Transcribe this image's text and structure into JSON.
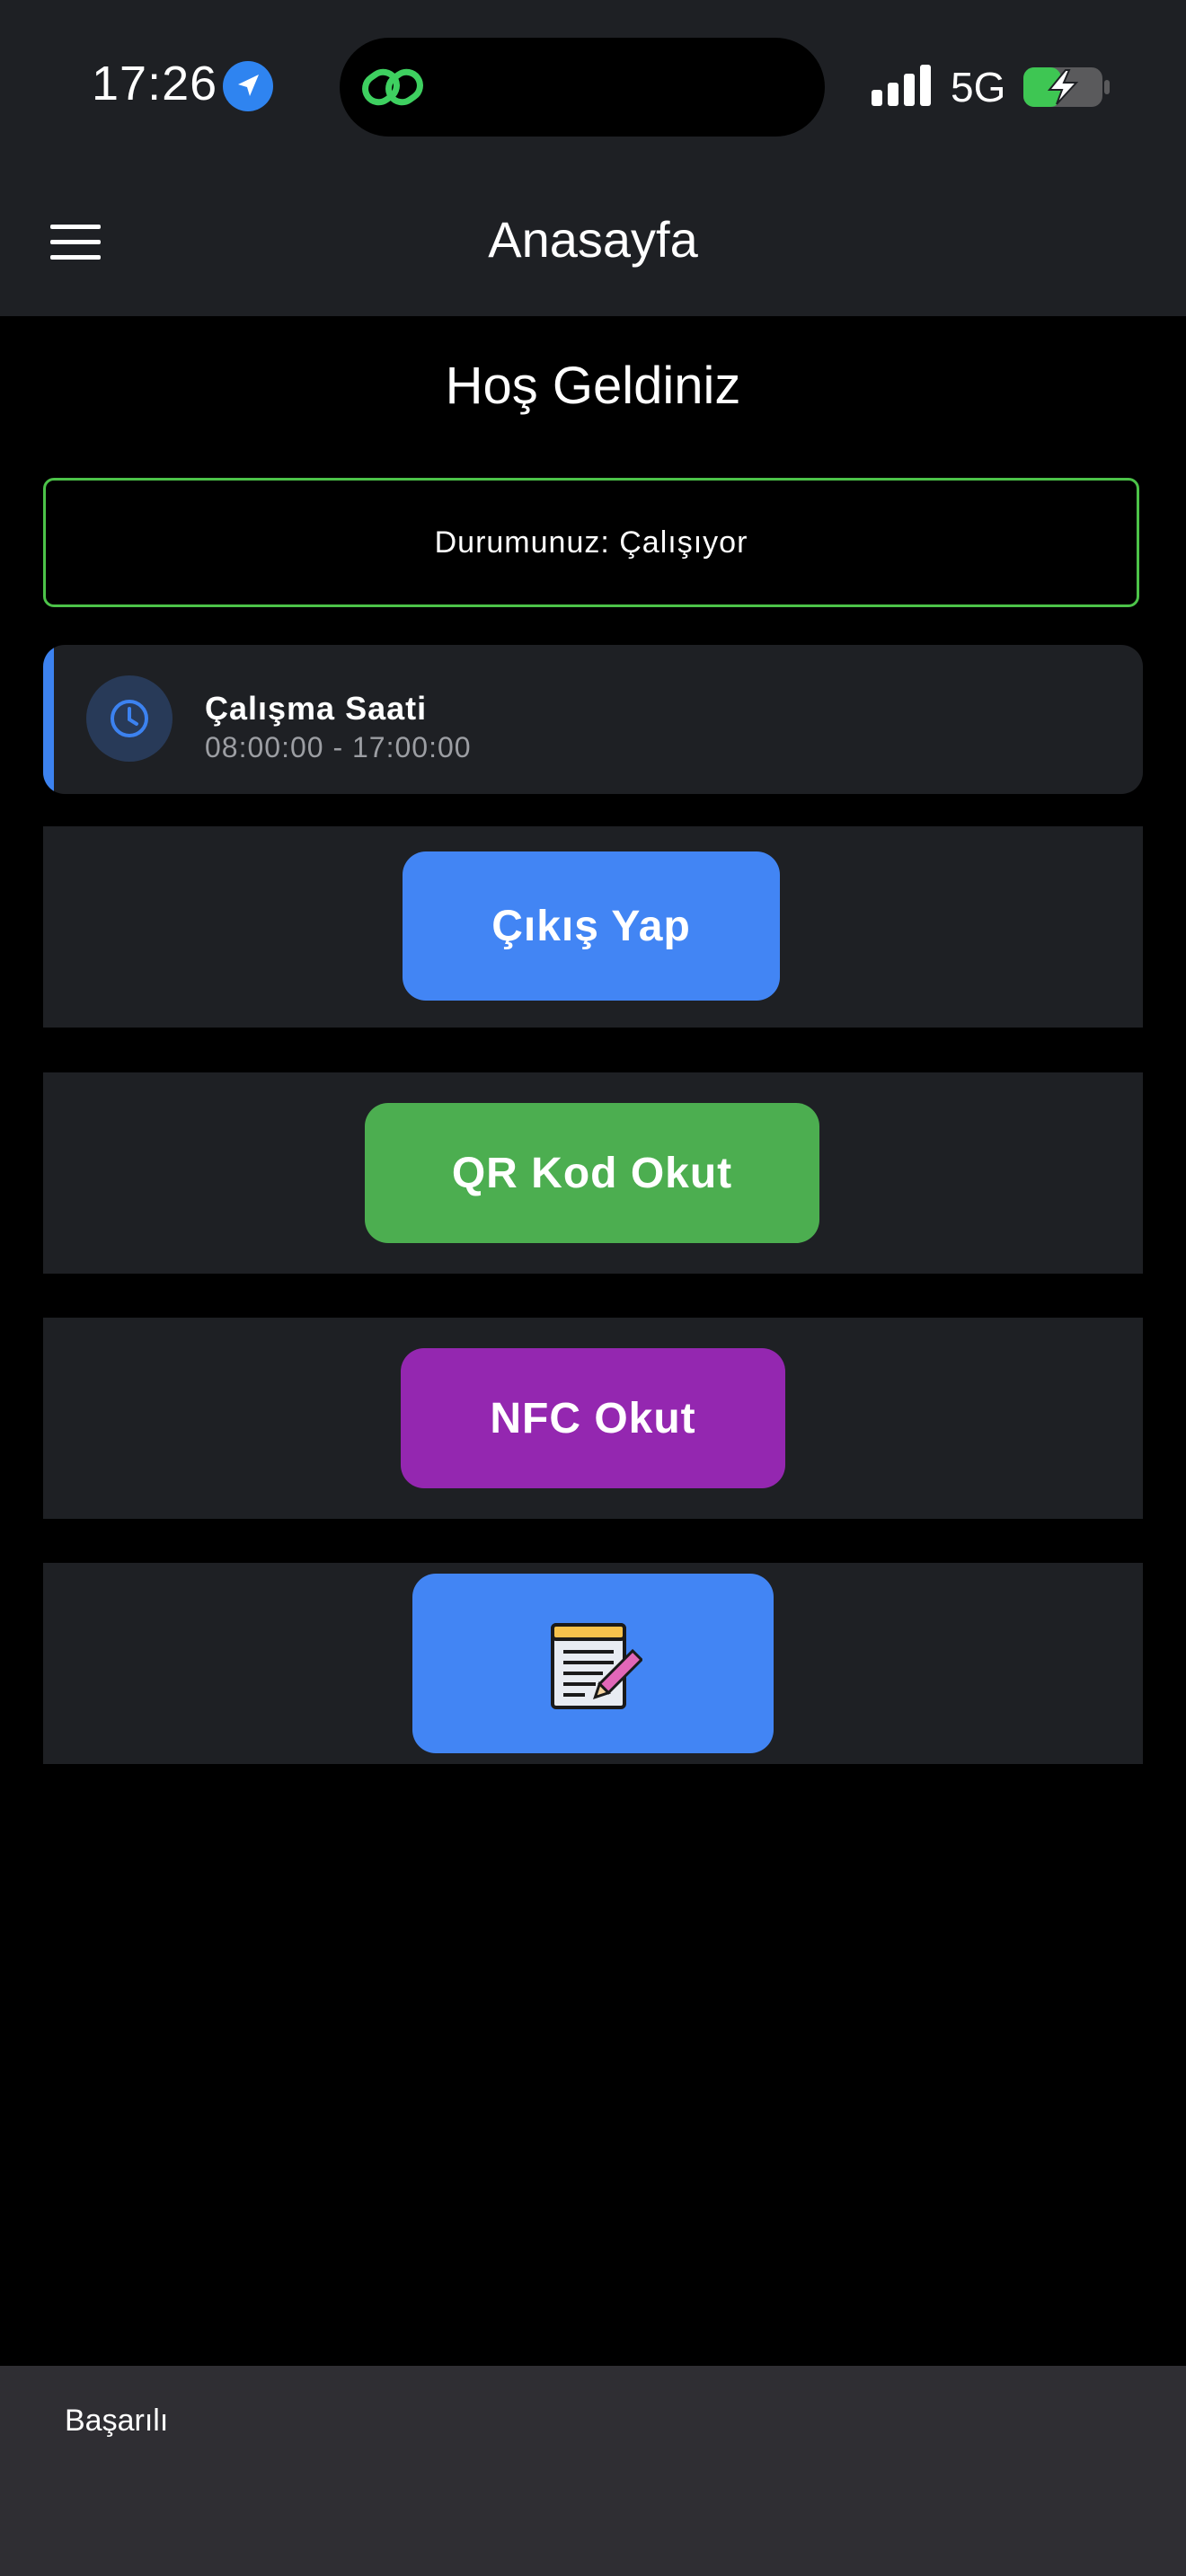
{
  "status_bar": {
    "time": "17:26",
    "network": "5G",
    "icons": [
      "location-arrow-icon",
      "link-icon",
      "signal-bars-icon",
      "battery-charging-icon"
    ]
  },
  "app_bar": {
    "title": "Anasayfa",
    "menu_icon": "hamburger-menu-icon"
  },
  "main": {
    "welcome": "Hoş Geldiniz",
    "status_text": "Durumunuz: Çalışıyor",
    "work_hours": {
      "title": "Çalışma Saati",
      "range": "08:00:00 - 17:00:00",
      "icon": "clock-icon"
    },
    "buttons": {
      "checkout": "Çıkış Yap",
      "qr": "QR Kod Okut",
      "nfc": "NFC Okut",
      "notes_icon": "notepad-pencil-icon"
    }
  },
  "snackbar": {
    "message": "Başarılı"
  },
  "colors": {
    "background": "#000000",
    "surface": "#1e2024",
    "status_border": "#4cc349",
    "accent_blue": "#4285f4",
    "qr_green": "#4cae50",
    "nfc_purple": "#9427b0",
    "snackbar": "#2f2e33"
  }
}
